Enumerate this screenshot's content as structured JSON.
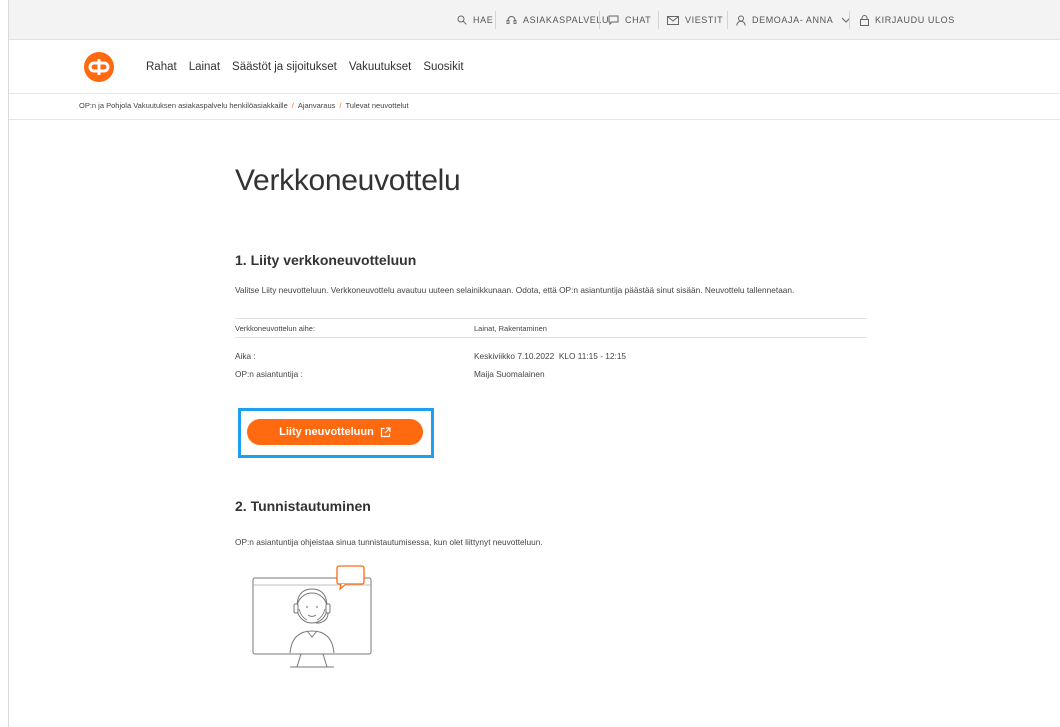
{
  "topbar": {
    "search": "HAE",
    "customer_service": "ASIAKASPALVELU",
    "chat": "CHAT",
    "messages": "VIESTIT",
    "user": "DEMOAJA- ANNA",
    "logout": "KIRJAUDU ULOS"
  },
  "nav": {
    "items": [
      "Rahat",
      "Lainat",
      "Säästöt ja sijoitukset",
      "Vakuutukset",
      "Suosikit"
    ]
  },
  "breadcrumb": {
    "items": [
      "OP:n ja Pohjola Vakuutuksen asiakaspalvelu henkilöasiakkaille",
      "Ajanvaraus",
      "Tulevat neuvottelut"
    ]
  },
  "page": {
    "title": "Verkkoneuvottelu",
    "section1_title": "1. Liity verkkoneuvotteluun",
    "section1_intro": "Valitse Liity neuvotteluun. Verkkoneuvottelu avautuu uuteen selainikkunaan. Odota, että OP:n asiantuntija päästää sinut sisään. Neuvottelu tallennetaan.",
    "details": {
      "topic_label": "Verkkoneuvottelun aihe:",
      "topic_value": "Lainat, Rakentaminen",
      "time_label": "Aika :",
      "time_value": "Keskiviikko 7.10.2022  KLO 11:15 - 12:15",
      "advisor_label": "OP:n asiantuntija :",
      "advisor_value": "Maija Suomalainen"
    },
    "join_button": "Liity neuvotteluun",
    "section2_title": "2. Tunnistautuminen",
    "section2_text": "OP:n asiantuntija ohjeistaa sinua tunnistautumisessa, kun olet liittynyt neuvotteluun."
  },
  "colors": {
    "brand": "#ff6a10",
    "highlight": "#1ea0f2"
  },
  "icons": [
    "search-icon",
    "headset-icon",
    "chat-icon",
    "mail-icon",
    "user-icon",
    "chevron-down-icon",
    "lock-icon",
    "external-link-icon"
  ]
}
